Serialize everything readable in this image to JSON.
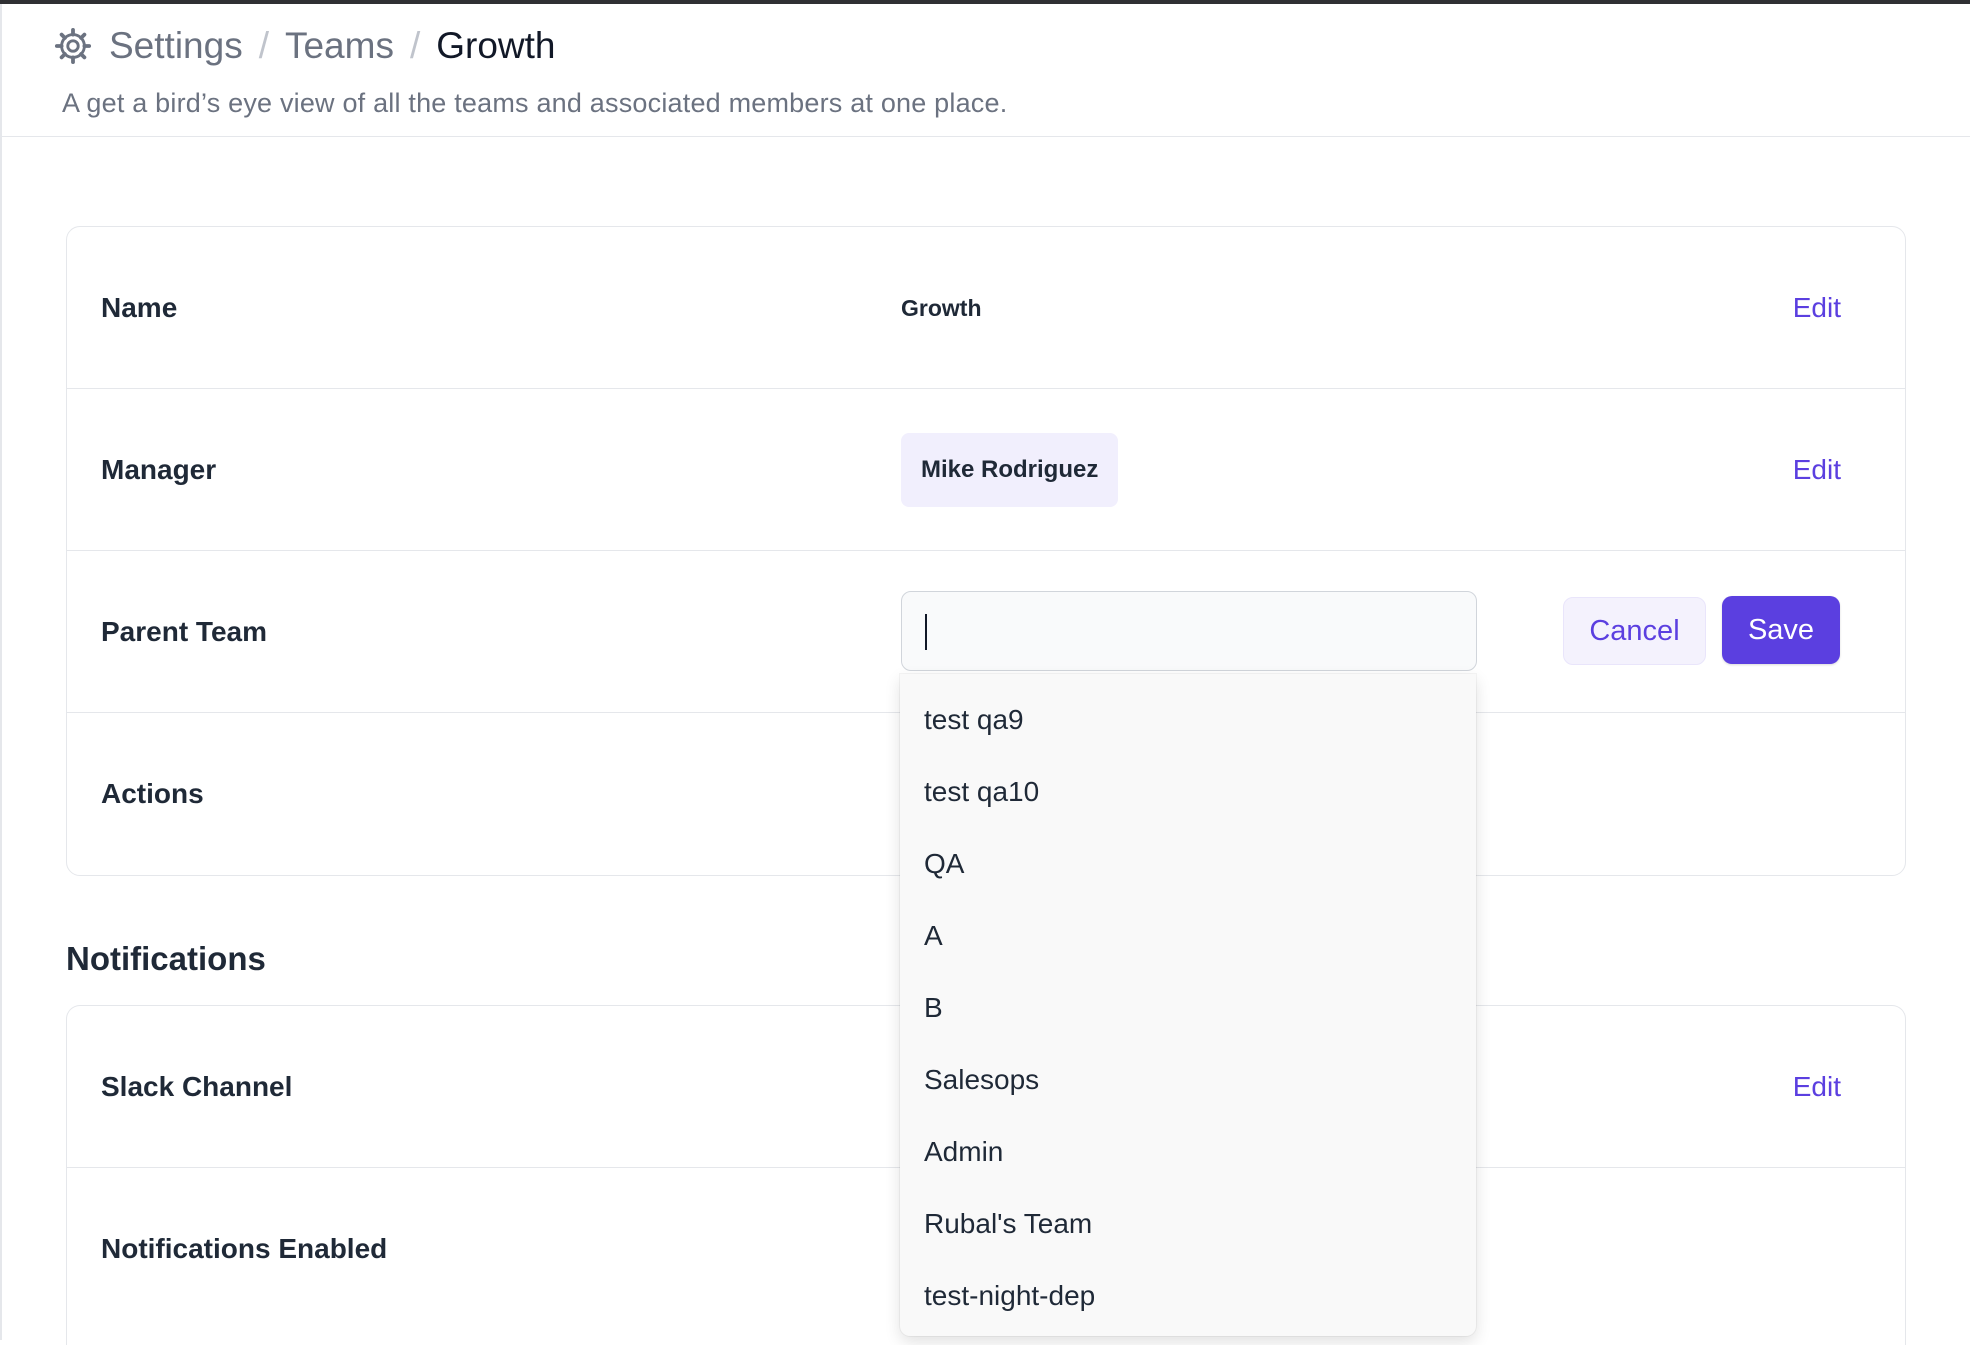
{
  "breadcrumb": {
    "items": [
      "Settings",
      "Teams",
      "Growth"
    ],
    "separator": "/"
  },
  "subtitle": "A get a bird’s eye view of all the teams and associated members at one place.",
  "team": {
    "name_label": "Name",
    "name_value": "Growth",
    "manager_label": "Manager",
    "manager_value": "Mike Rodriguez",
    "parent_label": "Parent Team",
    "parent_value": "",
    "actions_label": "Actions",
    "edit_label": "Edit",
    "cancel_label": "Cancel",
    "save_label": "Save"
  },
  "notifications": {
    "heading": "Notifications",
    "slack_label": "Slack Channel",
    "enabled_label": "Notifications Enabled",
    "edit_label": "Edit"
  },
  "dropdown_options": [
    "test qa9",
    "test qa10",
    "QA",
    "A",
    "B",
    "Salesops",
    "Admin",
    "Rubal's Team",
    "test-night-dep"
  ],
  "colors": {
    "accent": "#5b3fe0",
    "pill_bg": "#f1effd",
    "border": "#e5e7eb"
  },
  "icons": {
    "breadcrumb": "gear-icon"
  }
}
